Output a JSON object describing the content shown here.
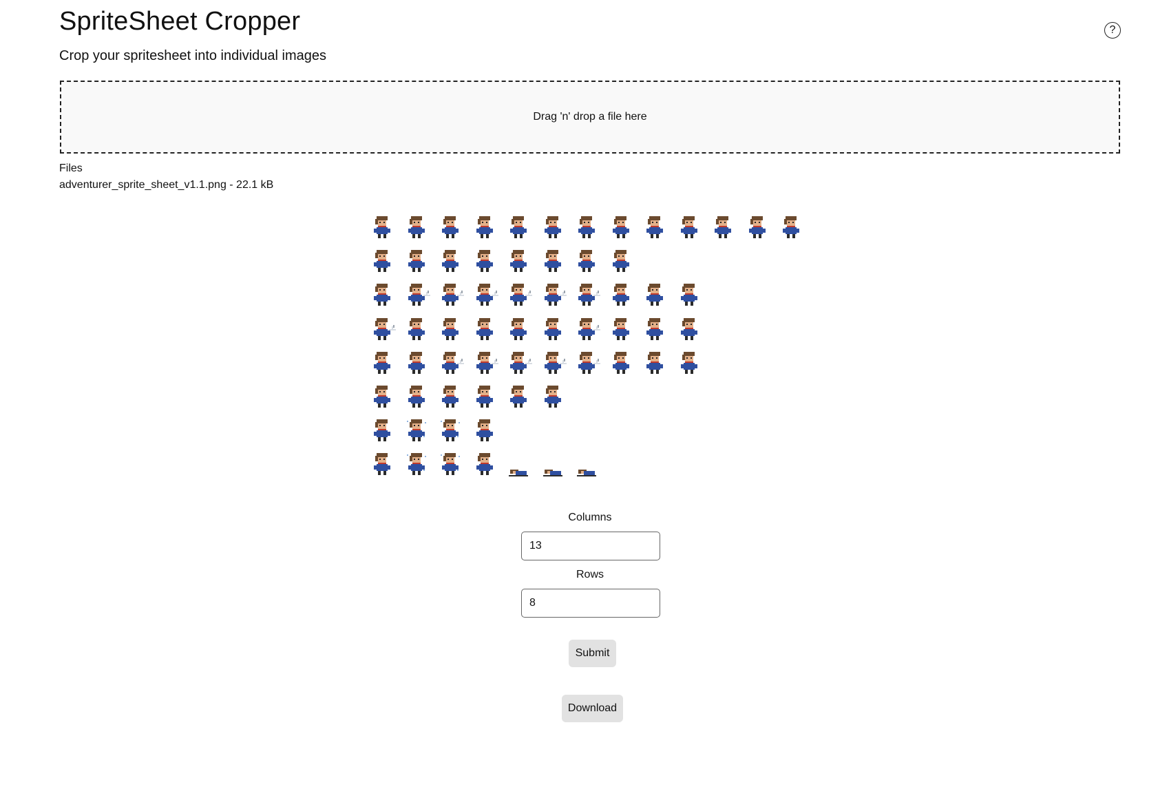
{
  "app": {
    "title": "SpriteSheet Cropper",
    "subtitle": "Crop your spritesheet into individual images",
    "help_glyph": "?"
  },
  "dropzone": {
    "text": "Drag 'n' drop a file here"
  },
  "files": {
    "heading": "Files",
    "items": [
      "adventurer_sprite_sheet_v1.1.png - 22.1 kB"
    ]
  },
  "spritesheet": {
    "row_frame_counts": [
      13,
      8,
      10,
      10,
      10,
      6,
      4,
      7
    ],
    "colors": {
      "hair": "#6b4a2e",
      "skin": "#e3b089",
      "tunic": "#2f4fa0",
      "scarf": "#c23a2b",
      "boots": "#2b2b2b",
      "sword": "#d8dde3"
    }
  },
  "form": {
    "columns_label": "Columns",
    "columns_value": "13",
    "rows_label": "Rows",
    "rows_value": "8",
    "submit_label": "Submit",
    "download_label": "Download"
  }
}
